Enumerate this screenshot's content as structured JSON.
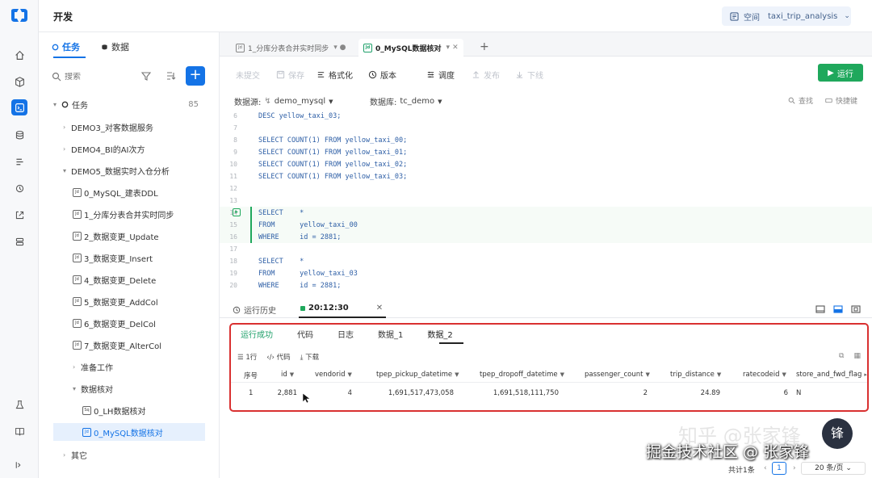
{
  "app": {
    "title": "开发"
  },
  "workspace": {
    "label": "空间",
    "value": "taxi_trip_analysis"
  },
  "rail": {
    "items": [
      "home-icon",
      "cube-icon",
      "develop-icon",
      "database-icon",
      "list-icon",
      "monitor-icon",
      "export-icon",
      "server-icon",
      "lab-icon",
      "book-icon",
      "collapse-icon"
    ]
  },
  "side": {
    "tabs": [
      {
        "label": "任务"
      },
      {
        "label": "数据"
      }
    ],
    "search_placeholder": "搜索",
    "root": {
      "label": "任务",
      "count": "85"
    },
    "items": [
      {
        "label": "DEMO3_对客数据服务",
        "type": "folder"
      },
      {
        "label": "DEMO4_BI的AI次方",
        "type": "folder"
      },
      {
        "label": "DEMO5_数据实时入仓分析",
        "type": "folder-open"
      },
      {
        "label": "0_MySQL_建表DDL",
        "icon": "Jd"
      },
      {
        "label": "1_分库分表合并实时同步",
        "icon": "Jd"
      },
      {
        "label": "2_数据变更_Update",
        "icon": "Jd"
      },
      {
        "label": "3_数据变更_Insert",
        "icon": "Jd"
      },
      {
        "label": "4_数据变更_Delete",
        "icon": "Jd"
      },
      {
        "label": "5_数据变更_AddCol",
        "icon": "Jd"
      },
      {
        "label": "6_数据变更_DelCol",
        "icon": "Jd"
      },
      {
        "label": "7_数据变更_AlterCol",
        "icon": "Jd"
      },
      {
        "label": "准备工作",
        "type": "folder"
      },
      {
        "label": "数据核对",
        "type": "folder-open"
      },
      {
        "label": "0_LH数据核对",
        "icon": "Sq"
      },
      {
        "label": "0_MySQL数据核对",
        "icon": "Jd",
        "selected": true
      },
      {
        "label": "其它",
        "type": "folder"
      }
    ]
  },
  "editor_tabs": [
    {
      "label": "1_分库分表合并实时同步",
      "icon": "Jd"
    },
    {
      "label": "0_MySQL数据核对",
      "icon": "Jd",
      "active": true
    }
  ],
  "toolbar": {
    "uncommitted": "未提交",
    "save": "保存",
    "format": "格式化",
    "version": "版本",
    "schedule": "调度",
    "publish": "发布",
    "offline": "下线",
    "run": "运行"
  },
  "source": {
    "datasource_label": "数据源:",
    "datasource": "demo_mysql",
    "database_label": "数据库:",
    "database": "tc_demo",
    "find": "查找",
    "shortcut": "快捷键"
  },
  "code_lines": [
    {
      "n": "6",
      "t": "DESC yellow_taxi_03;"
    },
    {
      "n": "7",
      "t": ""
    },
    {
      "n": "8",
      "t": "SELECT COUNT(1) FROM yellow_taxi_00;"
    },
    {
      "n": "9",
      "t": "SELECT COUNT(1) FROM yellow_taxi_01;"
    },
    {
      "n": "10",
      "t": "SELECT COUNT(1) FROM yellow_taxi_02;"
    },
    {
      "n": "11",
      "t": "SELECT COUNT(1) FROM yellow_taxi_03;"
    },
    {
      "n": "12",
      "t": ""
    },
    {
      "n": "13",
      "t": ""
    },
    {
      "n": "14",
      "t": "SELECT    *"
    },
    {
      "n": "15",
      "t": "FROM      yellow_taxi_00"
    },
    {
      "n": "16",
      "t": "WHERE     id = 2881;"
    },
    {
      "n": "17",
      "t": ""
    },
    {
      "n": "18",
      "t": "SELECT    *"
    },
    {
      "n": "19",
      "t": "FROM      yellow_taxi_03"
    },
    {
      "n": "20",
      "t": "WHERE     id = 2881;"
    }
  ],
  "bottom": {
    "history": "运行历史",
    "run_time": "20:12:30"
  },
  "result": {
    "tabs": [
      "运行成功",
      "代码",
      "日志",
      "数据_1",
      "数据_2"
    ],
    "tools": [
      "1行",
      "代码",
      "下载"
    ],
    "columns": [
      "序号",
      "id",
      "vendorid",
      "tpep_pickup_datetime",
      "tpep_dropoff_datetime",
      "passenger_count",
      "trip_distance",
      "ratecodeid",
      "store_and_fwd_flag"
    ],
    "rows": [
      [
        "1",
        "2,881",
        "4",
        "1,691,517,473,058",
        "1,691,518,111,750",
        "2",
        "24.89",
        "6",
        "N"
      ]
    ]
  },
  "pager": {
    "total": "共计1条",
    "page": "1",
    "size": "20 条/页"
  },
  "watermark": {
    "text": "掘金技术社区 @ 张家锋",
    "bg": "知乎 @张家锋"
  },
  "colors": {
    "accent": "#1473e6",
    "run": "#1fa85c",
    "highlight_box": "#d93030",
    "success": "#1fa06a"
  }
}
